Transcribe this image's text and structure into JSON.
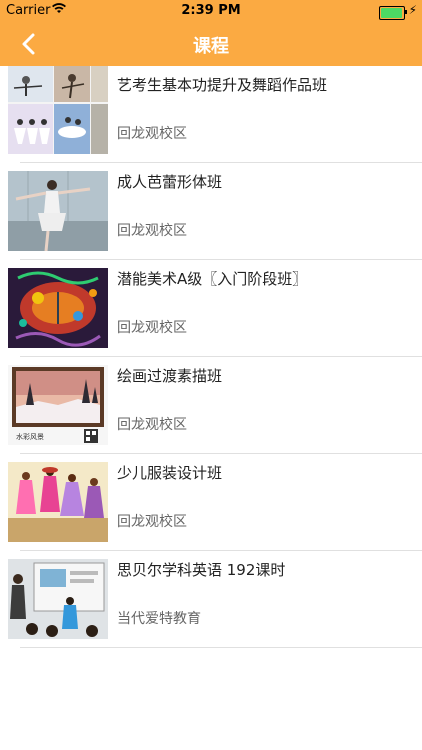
{
  "status": {
    "carrier": "Carrier",
    "time": "2:39 PM",
    "battery_level": 0.95
  },
  "nav": {
    "title": "课程"
  },
  "courses": [
    {
      "name": "艺考生基本功提升及舞蹈作品班",
      "campus": "回龙观校区",
      "thumb": "dance-class-collage"
    },
    {
      "name": "成人芭蕾形体班",
      "campus": "回龙观校区",
      "thumb": "ballet-dancer"
    },
    {
      "name": "潜能美术A级〖入门阶段班〗",
      "campus": "回龙观校区",
      "thumb": "colorful-drawing"
    },
    {
      "name": "绘画过渡素描班",
      "campus": "回龙观校区",
      "thumb": "watercolor-landscape"
    },
    {
      "name": "少儿服装设计班",
      "campus": "回龙观校区",
      "thumb": "fashion-dolls"
    },
    {
      "name": "思贝尔学科英语 192课时",
      "campus": "当代爱特教育",
      "thumb": "classroom"
    }
  ],
  "colors": {
    "nav_bg": "#fbaa42",
    "title_text": "#ffffff"
  }
}
